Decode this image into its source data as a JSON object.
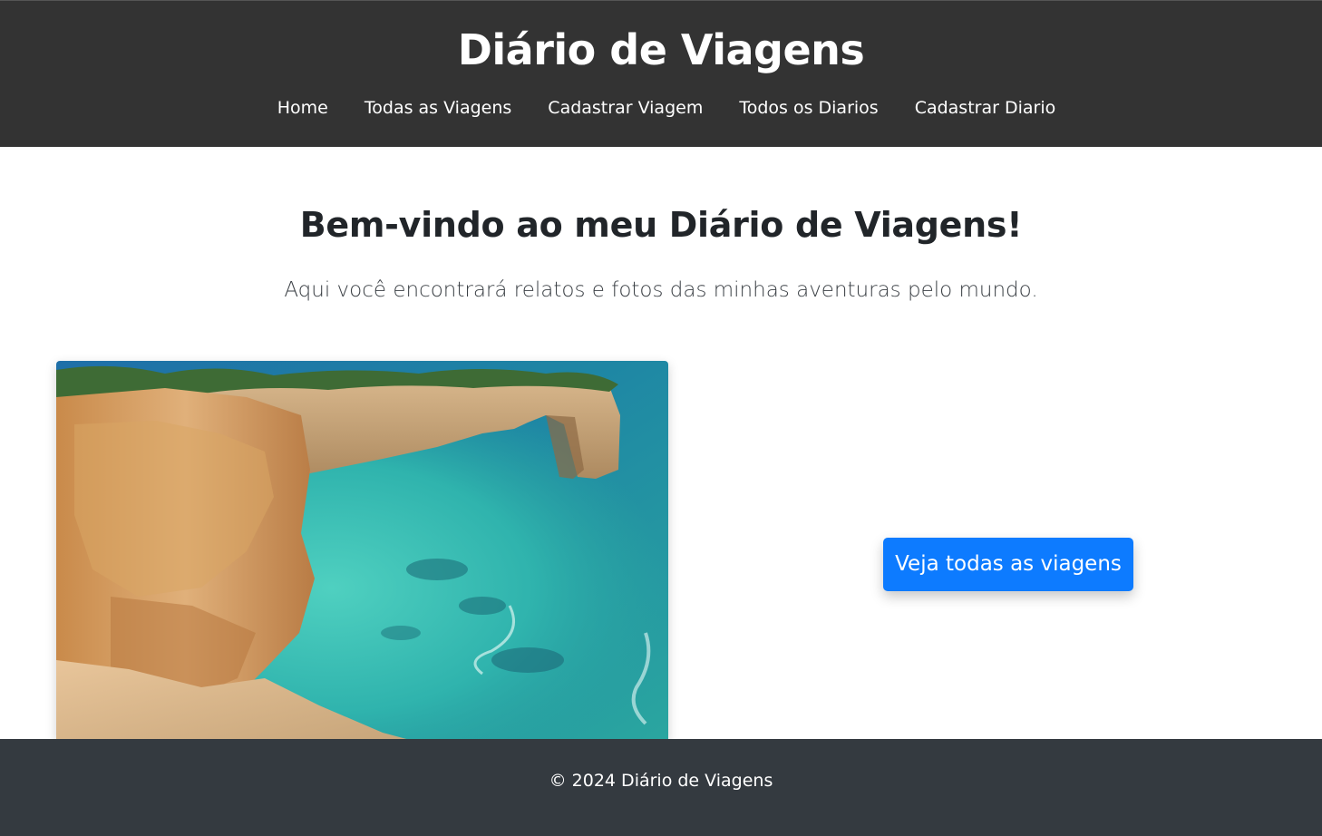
{
  "header": {
    "site_title": "Diário de Viagens",
    "nav": [
      {
        "label": "Home"
      },
      {
        "label": "Todas as Viagens"
      },
      {
        "label": "Cadastrar Viagem"
      },
      {
        "label": "Todos os Diarios"
      },
      {
        "label": "Cadastrar Diario"
      }
    ]
  },
  "main": {
    "title": "Bem-vindo ao meu Diário de Viagens!",
    "subtitle": "Aqui você encontrará relatos e fotos das minhas aventuras pelo mundo.",
    "hero_image": "coastal-cliff-arch-photo",
    "cta_label": "Veja todas as viagens"
  },
  "footer": {
    "text": "© 2024 Diário de Viagens"
  },
  "colors": {
    "header_bg": "#333333",
    "footer_bg": "#343a40",
    "primary": "#0d7bff",
    "text": "#212529"
  }
}
